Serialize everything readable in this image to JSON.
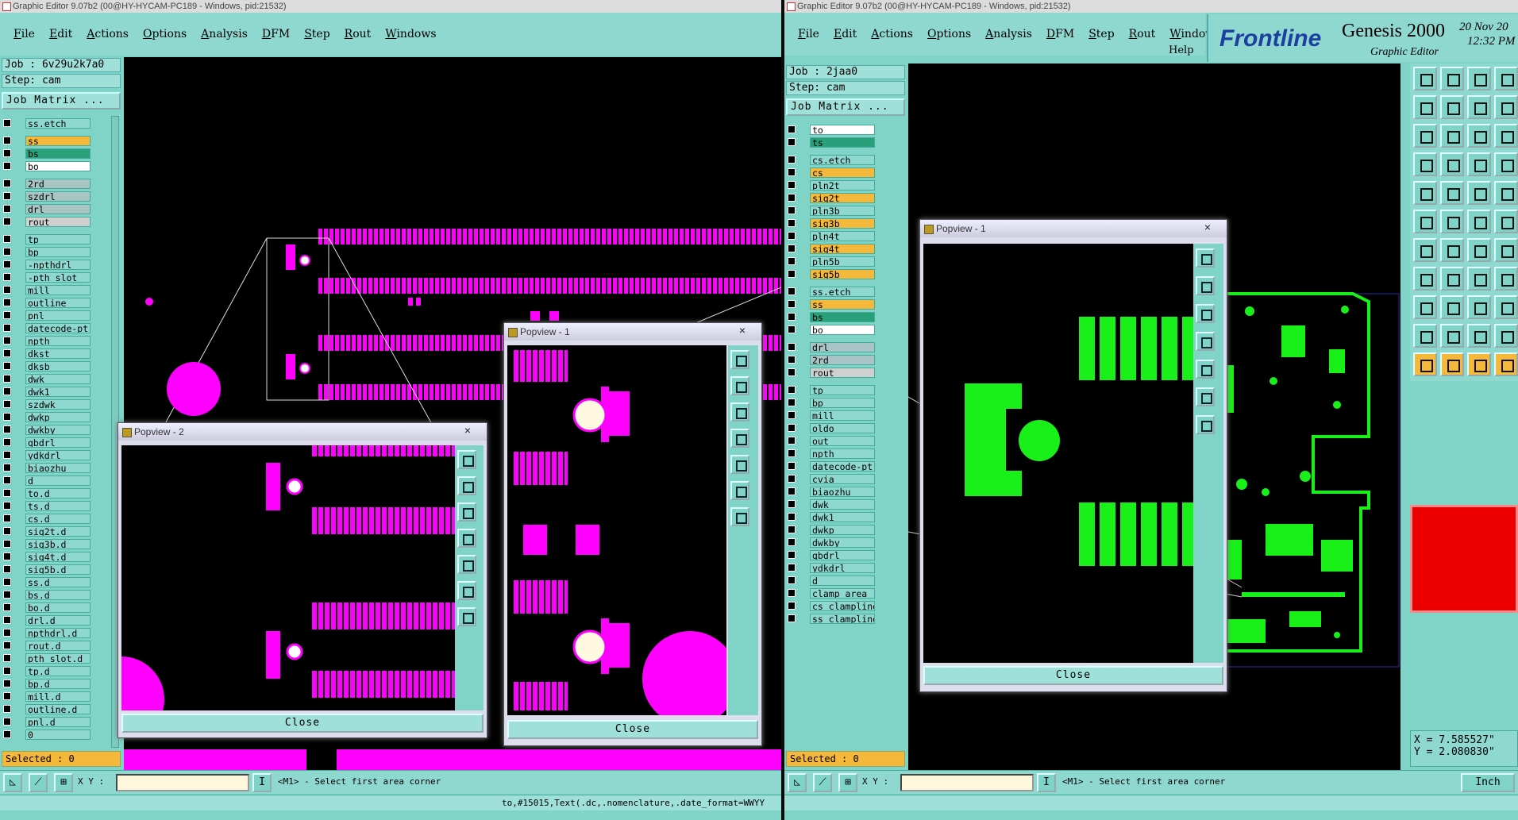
{
  "left": {
    "title": "Graphic Editor 9.07b2 (00@HY-HYCAM-PC189 - Windows, pid:21532)",
    "menu": [
      "File",
      "Edit",
      "Actions",
      "Options",
      "Analysis",
      "DFM",
      "Step",
      "Rout",
      "Windows"
    ],
    "job": "Job : 6v29u2k7a0",
    "step": "Step: cam",
    "job_matrix": "Job Matrix ...",
    "layers": [
      {
        "name": "ss.etch",
        "color": "#8fd8cf"
      },
      {
        "name": "ss",
        "color": "#f5b83a"
      },
      {
        "name": "bs",
        "color": "#2aa07a"
      },
      {
        "name": "bo",
        "color": "#ffffff"
      },
      {
        "name": "2rd",
        "color": "#a8c4c4"
      },
      {
        "name": "szdrl",
        "color": "#a8c4c4"
      },
      {
        "name": "drl",
        "color": "#a8c4c4"
      },
      {
        "name": "rout",
        "color": "#d0d0d0"
      },
      {
        "name": "tp",
        "color": "#8fd8cf"
      },
      {
        "name": "bp",
        "color": "#8fd8cf"
      },
      {
        "name": "-npthdrl",
        "color": "#8fd8cf"
      },
      {
        "name": "-pth_slot",
        "color": "#8fd8cf"
      },
      {
        "name": "mill",
        "color": "#8fd8cf"
      },
      {
        "name": "outline",
        "color": "#8fd8cf"
      },
      {
        "name": "pnl",
        "color": "#8fd8cf"
      },
      {
        "name": "datecode-pt",
        "color": "#8fd8cf"
      },
      {
        "name": "npth",
        "color": "#8fd8cf"
      },
      {
        "name": "dkst",
        "color": "#8fd8cf"
      },
      {
        "name": "dksb",
        "color": "#8fd8cf"
      },
      {
        "name": "dwk",
        "color": "#8fd8cf"
      },
      {
        "name": "dwk1",
        "color": "#8fd8cf"
      },
      {
        "name": "szdwk",
        "color": "#8fd8cf"
      },
      {
        "name": "dwkp",
        "color": "#8fd8cf"
      },
      {
        "name": "dwkby",
        "color": "#8fd8cf"
      },
      {
        "name": "gbdrl",
        "color": "#8fd8cf"
      },
      {
        "name": "ydkdrl",
        "color": "#8fd8cf"
      },
      {
        "name": "biaozhu",
        "color": "#8fd8cf"
      },
      {
        "name": "d",
        "color": "#8fd8cf"
      },
      {
        "name": "to.d",
        "color": "#8fd8cf"
      },
      {
        "name": "ts.d",
        "color": "#8fd8cf"
      },
      {
        "name": "cs.d",
        "color": "#8fd8cf"
      },
      {
        "name": "sig2t.d",
        "color": "#8fd8cf"
      },
      {
        "name": "sig3b.d",
        "color": "#8fd8cf"
      },
      {
        "name": "sig4t.d",
        "color": "#8fd8cf"
      },
      {
        "name": "sig5b.d",
        "color": "#8fd8cf"
      },
      {
        "name": "ss.d",
        "color": "#8fd8cf"
      },
      {
        "name": "bs.d",
        "color": "#8fd8cf"
      },
      {
        "name": "bo.d",
        "color": "#8fd8cf"
      },
      {
        "name": "drl.d",
        "color": "#8fd8cf"
      },
      {
        "name": "npthdrl.d",
        "color": "#8fd8cf"
      },
      {
        "name": "rout.d",
        "color": "#8fd8cf"
      },
      {
        "name": "pth_slot.d",
        "color": "#8fd8cf"
      },
      {
        "name": "tp.d",
        "color": "#8fd8cf"
      },
      {
        "name": "bp.d",
        "color": "#8fd8cf"
      },
      {
        "name": "mill.d",
        "color": "#8fd8cf"
      },
      {
        "name": "outline.d",
        "color": "#8fd8cf"
      },
      {
        "name": "pnl.d",
        "color": "#8fd8cf"
      },
      {
        "name": "0",
        "color": "#8fd8cf"
      }
    ],
    "selected": "Selected : 0",
    "xy_label": "X Y :",
    "prompt": "<M1> - Select first area corner",
    "bottom_text": "to,#15015,Text(.dc,.nomenclature,.date_format=WWYY",
    "popview2_title": "Popview - 2",
    "popview1_title": "Popview - 1",
    "close_label": "Close",
    "close_x": "×"
  },
  "right": {
    "title": "Graphic Editor 9.07b2 (00@HY-HYCAM-PC189 - Windows, pid:21532)",
    "menu": [
      "File",
      "Edit",
      "Actions",
      "Options",
      "Analysis",
      "DFM",
      "Step",
      "Rout",
      "Windows"
    ],
    "help": "Help",
    "brand": "Frontline",
    "product": "Genesis 2000",
    "product_sub": "Graphic Editor",
    "date": "20 Nov 20",
    "time": "12:32 PM",
    "job": "Job : 2jaa0",
    "step": "Step: cam",
    "job_matrix": "Job Matrix ...",
    "layers": [
      {
        "name": "to",
        "color": "#ffffff"
      },
      {
        "name": "ts",
        "color": "#2aa07a"
      },
      {
        "name": "cs.etch",
        "color": "#8fd8cf"
      },
      {
        "name": "cs",
        "color": "#f5b83a"
      },
      {
        "name": "pln2t",
        "color": "#8fd8cf"
      },
      {
        "name": "sig2t",
        "color": "#f5b83a"
      },
      {
        "name": "pln3b",
        "color": "#8fd8cf"
      },
      {
        "name": "sig3b",
        "color": "#f5b83a"
      },
      {
        "name": "pln4t",
        "color": "#8fd8cf"
      },
      {
        "name": "sig4t",
        "color": "#f5b83a"
      },
      {
        "name": "pln5b",
        "color": "#8fd8cf"
      },
      {
        "name": "sig5b",
        "color": "#f5b83a"
      },
      {
        "name": "ss.etch",
        "color": "#8fd8cf"
      },
      {
        "name": "ss",
        "color": "#f5b83a"
      },
      {
        "name": "bs",
        "color": "#2aa07a"
      },
      {
        "name": "bo",
        "color": "#ffffff"
      },
      {
        "name": "drl",
        "color": "#a8c4c4"
      },
      {
        "name": "2rd",
        "color": "#a8c4c4"
      },
      {
        "name": "rout",
        "color": "#d0d0d0"
      },
      {
        "name": "tp",
        "color": "#8fd8cf"
      },
      {
        "name": "bp",
        "color": "#8fd8cf"
      },
      {
        "name": "mill",
        "color": "#8fd8cf"
      },
      {
        "name": "oldo",
        "color": "#8fd8cf"
      },
      {
        "name": "out",
        "color": "#8fd8cf"
      },
      {
        "name": "npth",
        "color": "#8fd8cf"
      },
      {
        "name": "datecode-pt",
        "color": "#8fd8cf"
      },
      {
        "name": "cvia",
        "color": "#8fd8cf"
      },
      {
        "name": "biaozhu",
        "color": "#8fd8cf"
      },
      {
        "name": "dwk",
        "color": "#8fd8cf"
      },
      {
        "name": "dwk1",
        "color": "#8fd8cf"
      },
      {
        "name": "dwkp",
        "color": "#8fd8cf"
      },
      {
        "name": "dwkby",
        "color": "#8fd8cf"
      },
      {
        "name": "gbdrl",
        "color": "#8fd8cf"
      },
      {
        "name": "ydkdrl",
        "color": "#8fd8cf"
      },
      {
        "name": "d",
        "color": "#8fd8cf"
      },
      {
        "name": "clamp_area",
        "color": "#8fd8cf"
      },
      {
        "name": "cs_clampline",
        "color": "#8fd8cf"
      },
      {
        "name": "ss_clampline",
        "color": "#8fd8cf"
      }
    ],
    "selected": "Selected : 0",
    "xy_label": "X Y :",
    "prompt": "<M1> - Select first area corner",
    "popview_title": "Popview - 1",
    "close_label": "Close",
    "close_x": "×",
    "x_coord": "X = 7.585527\"",
    "y_coord": "Y = 2.080830\"",
    "units": "Inch"
  }
}
